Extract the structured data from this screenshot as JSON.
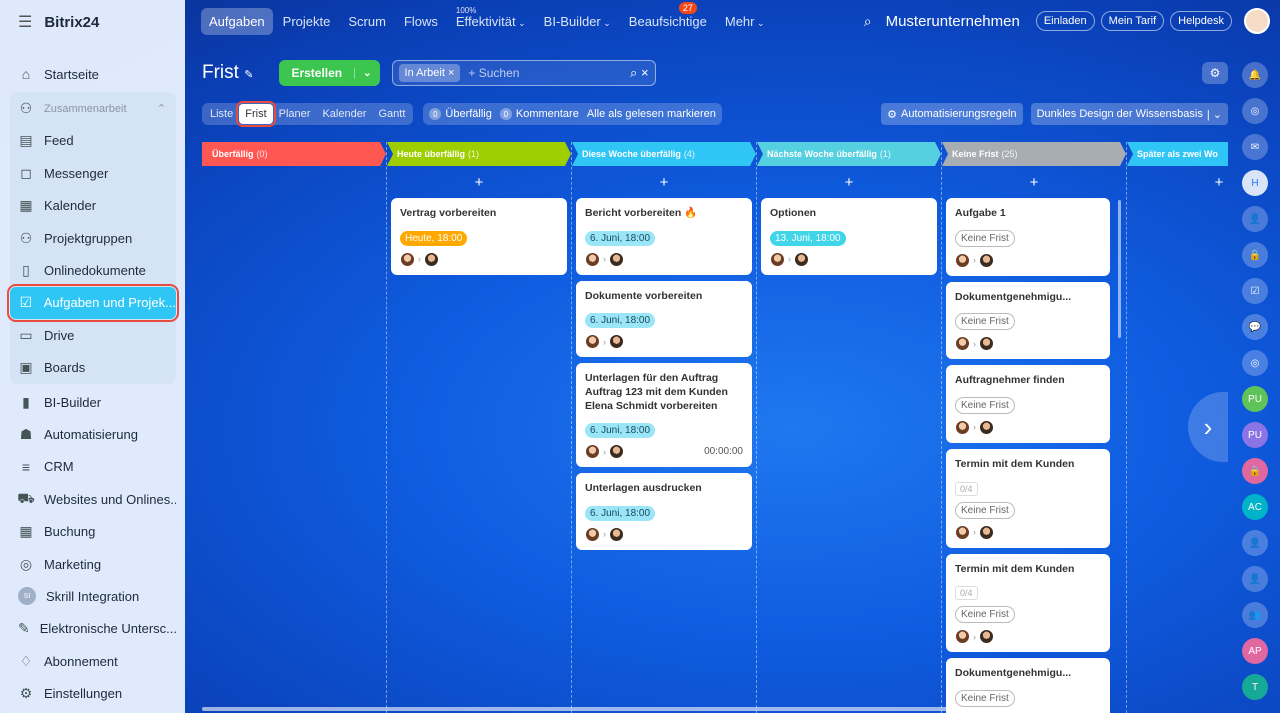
{
  "app": {
    "logo": "Bitrix24",
    "logo_sup": "©"
  },
  "sidebar": {
    "items": [
      {
        "label": "Startseite",
        "icon": "house-icon"
      },
      {
        "label": "Zusammenarbeit",
        "icon": "collab-icon"
      },
      {
        "label": "Feed",
        "icon": "feed-icon"
      },
      {
        "label": "Messenger",
        "icon": "chat-icon"
      },
      {
        "label": "Kalender",
        "icon": "calendar-icon"
      },
      {
        "label": "Projektgruppen",
        "icon": "group-icon"
      },
      {
        "label": "Onlinedokumente",
        "icon": "document-icon"
      },
      {
        "label": "Aufgaben und Projek...",
        "icon": "checkbox-icon"
      },
      {
        "label": "Drive",
        "icon": "drive-icon"
      },
      {
        "label": "Boards",
        "icon": "board-icon"
      },
      {
        "label": "BI-Builder",
        "icon": "bars-icon"
      },
      {
        "label": "Automatisierung",
        "icon": "robot-icon"
      },
      {
        "label": "CRM",
        "icon": "crm-icon"
      },
      {
        "label": "Websites und Onlines...",
        "icon": "cart-icon"
      },
      {
        "label": "Buchung",
        "icon": "booking-icon"
      },
      {
        "label": "Marketing",
        "icon": "target-icon"
      },
      {
        "label": "Skrill Integration",
        "icon": "si-badge",
        "badge": "SI"
      },
      {
        "label": "Elektronische Untersc...",
        "icon": "sign-icon"
      },
      {
        "label": "Abonnement",
        "icon": "subscription-icon"
      },
      {
        "label": "Einstellungen",
        "icon": "gear-icon"
      }
    ]
  },
  "topnav": {
    "items": [
      "Aufgaben",
      "Projekte",
      "Scrum",
      "Flows",
      "Effektivität",
      "BI-Builder",
      "Beaufsichtige",
      "Mehr"
    ],
    "effectivity_pct": "100%",
    "beaufsichtige_badge": "27"
  },
  "topright": {
    "company": "Musterunternehmen",
    "invite": "Einladen",
    "tariff": "Mein Tarif",
    "help": "Helpdesk"
  },
  "page": {
    "title": "Frist",
    "create": "Erstellen",
    "search_chip": "In Arbeit",
    "search_placeholder": "+ Suchen"
  },
  "views": [
    "Liste",
    "Frist",
    "Planer",
    "Kalender",
    "Gantt"
  ],
  "counters": {
    "overdue_count": "0",
    "overdue": "Überfällig",
    "comments_count": "0",
    "comments": "Kommentare",
    "mark_read": "Alle als gelesen markieren"
  },
  "toolbar_right": {
    "automation": "Automatisierungsregeln",
    "theme": "Dunkles Design der Wissensbasis"
  },
  "columns": [
    {
      "title": "Überfällig",
      "count": "(0)",
      "color": "#ff5752",
      "cards": []
    },
    {
      "title": "Heute überfällig",
      "count": "(1)",
      "color": "#9dcf00",
      "cards": [
        {
          "title": "Vertrag vorbereiten",
          "deadline": "Heute, 18:00",
          "style": "orange"
        }
      ]
    },
    {
      "title": "Diese Woche überfällig",
      "count": "(4)",
      "color": "#2fc6f6",
      "cards": [
        {
          "title": "Bericht vorbereiten 🔥",
          "deadline": "6. Juni, 18:00",
          "style": "cyan"
        },
        {
          "title": "Dokumente vorbereiten",
          "deadline": "6. Juni, 18:00",
          "style": "cyan"
        },
        {
          "title": "Unterlagen für den Auftrag Auftrag 123 mit dem Kunden Elena Schmidt vorbereiten",
          "deadline": "6. Juni, 18:00",
          "style": "cyan",
          "timer": "00:00:00"
        },
        {
          "title": "Unterlagen ausdrucken",
          "deadline": "6. Juni, 18:00",
          "style": "cyan"
        }
      ]
    },
    {
      "title": "Nächste Woche überfällig",
      "count": "(1)",
      "color": "#55d0e0",
      "cards": [
        {
          "title": "Optionen",
          "deadline": "13. Juni, 18:00",
          "style": "teal"
        }
      ]
    },
    {
      "title": "Keine Frist",
      "count": "(25)",
      "color": "#a8adb4",
      "cards": [
        {
          "title": "Aufgabe 1",
          "deadline": "Keine Frist",
          "style": "none"
        },
        {
          "title": "Dokumentgenehmigu...",
          "deadline": "Keine Frist",
          "style": "none"
        },
        {
          "title": "Auftragnehmer finden",
          "deadline": "Keine Frist",
          "style": "none"
        },
        {
          "title": "Termin mit dem Kunden",
          "deadline": "Keine Frist",
          "style": "none",
          "checklist": "0/4"
        },
        {
          "title": "Termin mit dem Kunden",
          "deadline": "Keine Frist",
          "style": "none",
          "checklist": "0/4"
        },
        {
          "title": "Dokumentgenehmigu...",
          "deadline": "Keine Frist",
          "style": "none"
        }
      ]
    },
    {
      "title": "Später als zwei Wo",
      "count": "",
      "color": "#2fc6f6",
      "cards": []
    }
  ],
  "rightbar": [
    "H",
    "PU",
    "PU",
    "AC",
    "AP",
    "T"
  ]
}
